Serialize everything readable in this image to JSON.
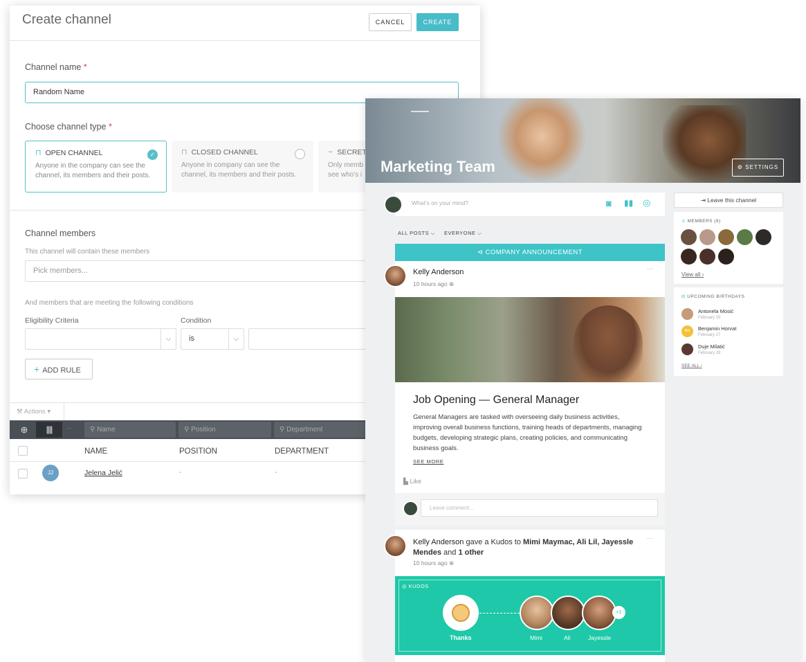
{
  "create_channel": {
    "title": "Create channel",
    "cancel_label": "CANCEL",
    "create_label": "CREATE",
    "channel_name_label": "Channel name",
    "required_mark": "*",
    "channel_name_value": "Random Name",
    "channel_type_label": "Choose channel type",
    "types": [
      {
        "title": "OPEN CHANNEL",
        "desc1": "Anyone in the company can see the",
        "desc2": "channel, its members and their posts."
      },
      {
        "title": "CLOSED CHANNEL",
        "desc1": "Anyone in company can see the",
        "desc2": "channel, its members and their posts."
      },
      {
        "title": "SECRET",
        "desc1": "Only memb",
        "desc2": "see who's i"
      }
    ],
    "members_label": "Channel members",
    "members_sub": "This channel will contain these members",
    "members_placeholder": "Pick members...",
    "conditions_sub": "And members that are meeting the following conditions",
    "eligibility_label": "Eligibility Criteria",
    "condition_label": "Condition",
    "condition_value": "is",
    "add_rule_label": "ADD RULE",
    "actions_label": "Actions",
    "filters": {
      "name": "Name",
      "position": "Position",
      "department": "Department"
    },
    "columns": [
      "NAME",
      "POSITION",
      "DEPARTMENT"
    ],
    "rows": [
      {
        "initials": "JJ",
        "name": "Jelena Jelić",
        "position": "-",
        "department": "-"
      }
    ]
  },
  "channel": {
    "title": "Marketing Team",
    "settings_label": "SETTINGS",
    "composer_placeholder": "What's on your mind?",
    "filter_all": "ALL POSTS",
    "filter_everyone": "EVERYONE",
    "announcement": "COMPANY ANNOUNCEMENT",
    "post1": {
      "author": "Kelly Anderson",
      "time": "10 hours ago",
      "more": "···",
      "heading": "Job Opening — General Manager",
      "body": "General Managers are tasked with overseeing daily business activities, improving overall business functions, training heads of departments, managing budgets, developing strategic plans, creating policies, and communicating business goals.",
      "see_more": "SEE MORE",
      "like": "Like",
      "comment_placeholder": "Leave comment..."
    },
    "post2": {
      "author": "Kelly Anderson",
      "action": "gave a Kudos to",
      "recipients": "Mimi Maymac, Ali Lil, Jayessle Mendes",
      "and": "and",
      "other": "1 other",
      "time": "10 hours ago",
      "more": "···",
      "kudos_label": "KUDOS",
      "badge": "Thanks",
      "people": [
        "Mimi",
        "Ali",
        "Jayessle"
      ],
      "extra": "+1"
    },
    "sidebar": {
      "leave": "Leave this channel",
      "members_title": "MEMBERS (8)",
      "view_all": "View all",
      "birthdays_title": "UPCOMING BIRTHDAYS",
      "birthdays": [
        {
          "name": "Antonela Mosić",
          "date": "February 25",
          "initials": ""
        },
        {
          "name": "Benjamin Horvat",
          "date": "February 27",
          "initials": "BH"
        },
        {
          "name": "Duje Milatić",
          "date": "February 28",
          "initials": ""
        }
      ],
      "see_all": "SEE ALL"
    }
  }
}
